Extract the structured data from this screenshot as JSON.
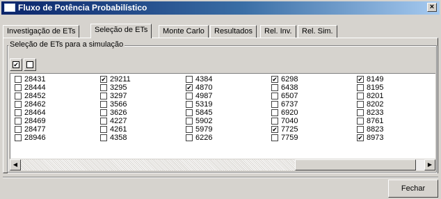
{
  "window": {
    "title": "Fluxo de Potência Probabilístico",
    "close_glyph": "×"
  },
  "tabs": [
    {
      "label": "Investigação de ETs",
      "active": false
    },
    {
      "label": "Seleção de ETs",
      "active": true
    },
    {
      "label": "Monte Carlo",
      "active": false
    },
    {
      "label": "Resultados",
      "active": false
    },
    {
      "label": "Rel. Inv.",
      "active": false
    },
    {
      "label": "Rel. Sim.",
      "active": false
    }
  ],
  "group": {
    "legend": "Seleção de ETs para a simulação"
  },
  "toolbar": {
    "check_all_icon": "checked-box-icon",
    "uncheck_all_icon": "empty-box-icon",
    "check_glyph": "✔"
  },
  "columns": [
    [
      {
        "label": "28431",
        "checked": false
      },
      {
        "label": "28444",
        "checked": false
      },
      {
        "label": "28452",
        "checked": false
      },
      {
        "label": "28462",
        "checked": false
      },
      {
        "label": "28464",
        "checked": false
      },
      {
        "label": "28469",
        "checked": false
      },
      {
        "label": "28477",
        "checked": false
      },
      {
        "label": "28946",
        "checked": false
      }
    ],
    [
      {
        "label": "29211",
        "checked": true
      },
      {
        "label": "3295",
        "checked": false
      },
      {
        "label": "3297",
        "checked": false
      },
      {
        "label": "3566",
        "checked": false
      },
      {
        "label": "3626",
        "checked": false
      },
      {
        "label": "4227",
        "checked": false
      },
      {
        "label": "4261",
        "checked": false
      },
      {
        "label": "4358",
        "checked": false
      }
    ],
    [
      {
        "label": "4384",
        "checked": false
      },
      {
        "label": "4870",
        "checked": true
      },
      {
        "label": "4987",
        "checked": false
      },
      {
        "label": "5319",
        "checked": false
      },
      {
        "label": "5845",
        "checked": false
      },
      {
        "label": "5902",
        "checked": false
      },
      {
        "label": "5979",
        "checked": false
      },
      {
        "label": "6226",
        "checked": false
      }
    ],
    [
      {
        "label": "6298",
        "checked": true
      },
      {
        "label": "6438",
        "checked": false
      },
      {
        "label": "6507",
        "checked": false
      },
      {
        "label": "6737",
        "checked": false
      },
      {
        "label": "6920",
        "checked": false
      },
      {
        "label": "7040",
        "checked": false
      },
      {
        "label": "7725",
        "checked": true
      },
      {
        "label": "7759",
        "checked": false
      }
    ],
    [
      {
        "label": "8149",
        "checked": true
      },
      {
        "label": "8195",
        "checked": false
      },
      {
        "label": "8201",
        "checked": false
      },
      {
        "label": "8202",
        "checked": false
      },
      {
        "label": "8233",
        "checked": false
      },
      {
        "label": "8761",
        "checked": false
      },
      {
        "label": "8823",
        "checked": false
      },
      {
        "label": "8973",
        "checked": true
      }
    ]
  ],
  "scrollbar": {
    "left_arrow": "◀",
    "right_arrow": "▶"
  },
  "footer": {
    "close_label": "Fechar"
  }
}
